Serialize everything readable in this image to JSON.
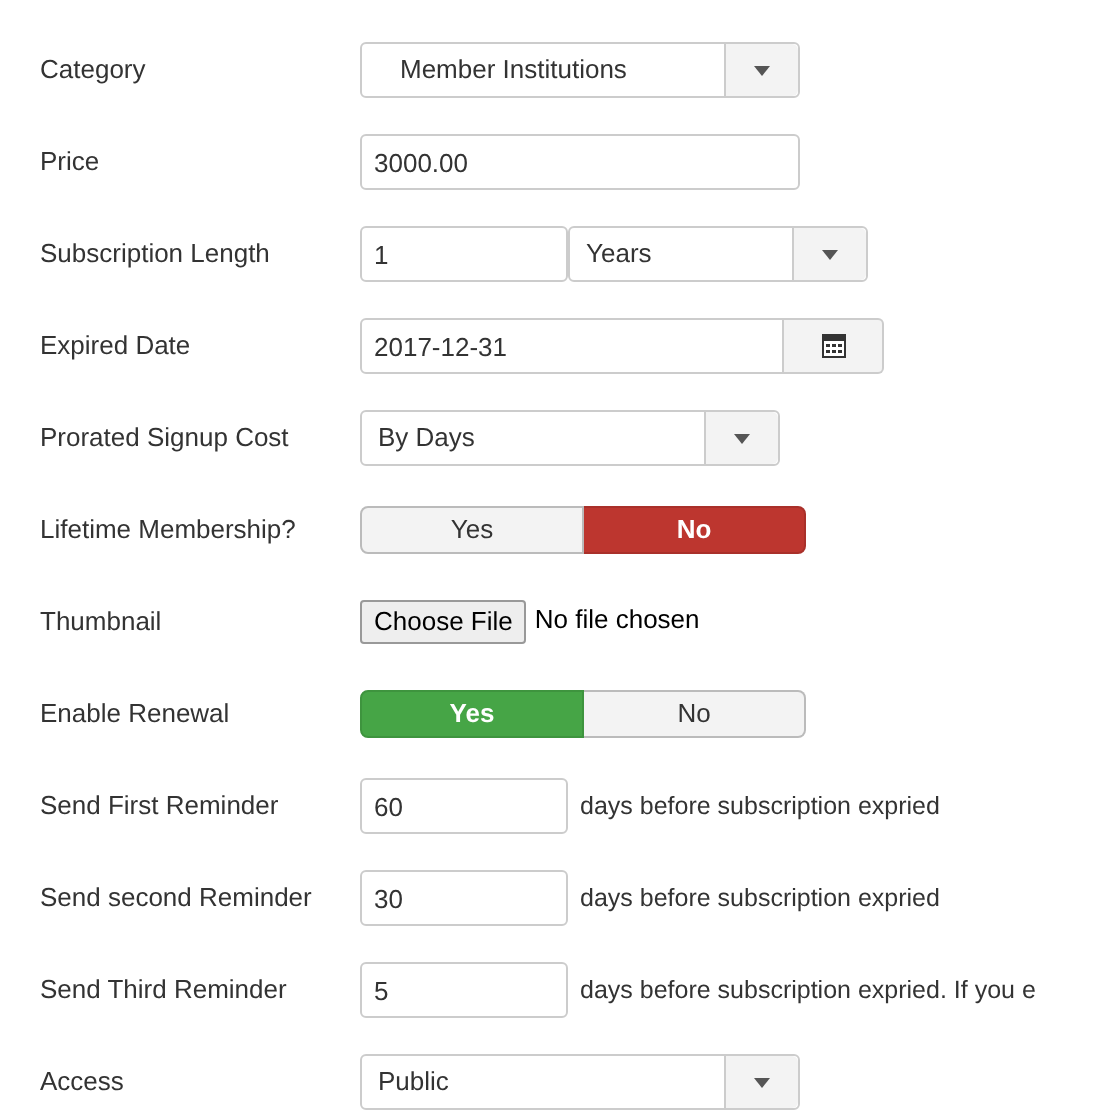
{
  "fields": [
    {
      "label": "Category",
      "kind": "select",
      "value": "Member Institutions",
      "centered": true
    },
    {
      "label": "Price",
      "kind": "text",
      "value": "3000.00"
    },
    {
      "label": "Subscription Length",
      "kind": "number_select",
      "value": "1",
      "unit": "Years"
    },
    {
      "label": "Expired Date",
      "kind": "date",
      "value": "2017-12-31"
    },
    {
      "label": "Prorated Signup Cost",
      "kind": "select_small",
      "value": "By Days"
    },
    {
      "label": "Lifetime Membership?",
      "kind": "toggle",
      "options": [
        {
          "label": "Yes",
          "selected": false
        },
        {
          "label": "No",
          "selected": true
        }
      ]
    },
    {
      "label": "Thumbnail",
      "kind": "file",
      "button": "Choose File",
      "status": "No file chosen"
    },
    {
      "label": "Enable Renewal",
      "kind": "toggle",
      "options": [
        {
          "label": "Yes",
          "selected": true
        },
        {
          "label": "No",
          "selected": false
        }
      ]
    },
    {
      "label": "Send First Reminder",
      "kind": "number_suffix",
      "value": "60",
      "suffix": "days before subscription expried"
    },
    {
      "label": "Send second Reminder",
      "kind": "number_suffix",
      "value": "30",
      "suffix": "days before subscription expried"
    },
    {
      "label": "Send Third Reminder",
      "kind": "number_suffix",
      "value": "5",
      "suffix": "days before subscription expried. If you e"
    },
    {
      "label": "Access",
      "kind": "select",
      "value": "Public"
    }
  ]
}
